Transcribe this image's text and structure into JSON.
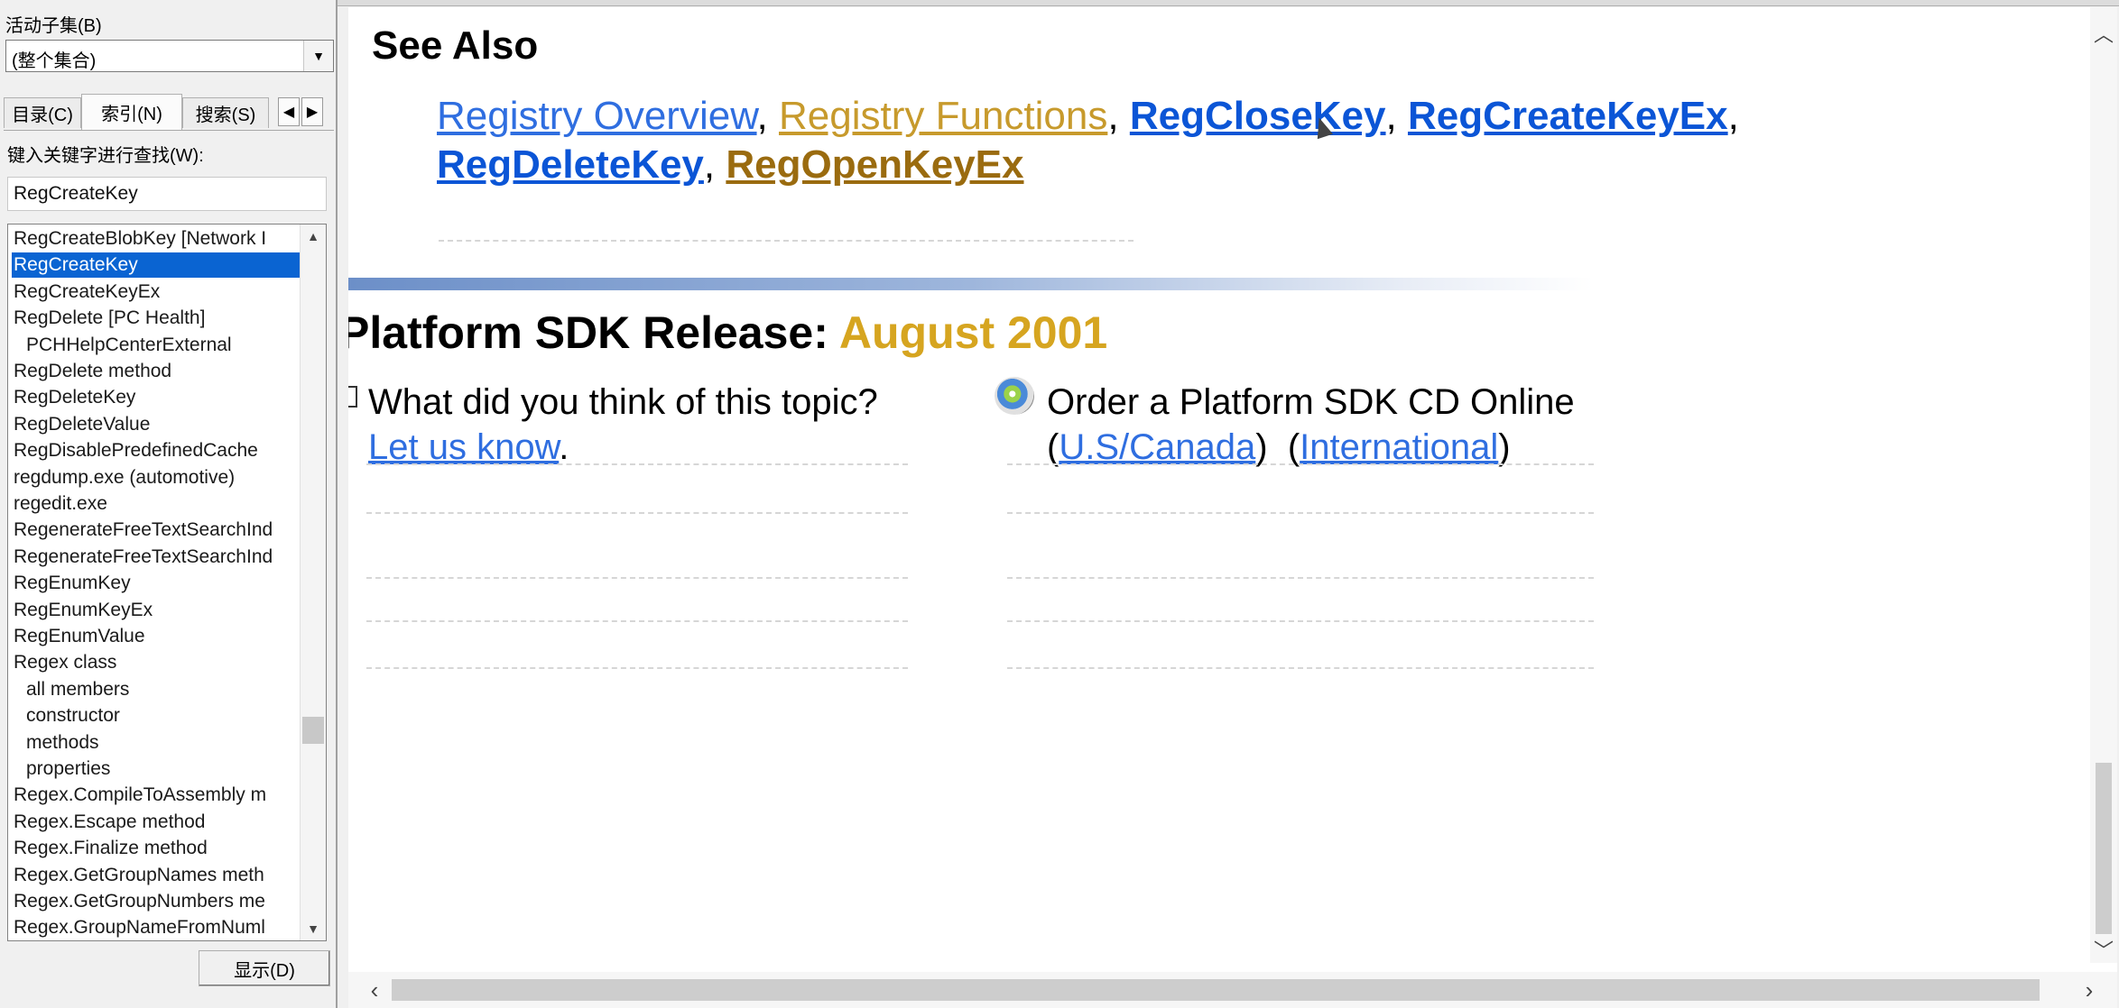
{
  "nav": {
    "subset_label": "活动子集(B)",
    "subset_value": "(整个集合)",
    "tabs": [
      {
        "label": "目录(C)"
      },
      {
        "label": "索引(N)"
      },
      {
        "label": "搜索(S)"
      }
    ],
    "keyword_label": "键入关键字进行查找(W):",
    "keyword_value": "RegCreateKey",
    "index_items": [
      {
        "label": "RegCreateBlobKey [Network I",
        "indent": false,
        "selected": false
      },
      {
        "label": "RegCreateKey",
        "indent": false,
        "selected": true
      },
      {
        "label": "RegCreateKeyEx",
        "indent": false,
        "selected": false
      },
      {
        "label": "RegDelete [PC Health]",
        "indent": false,
        "selected": false
      },
      {
        "label": "PCHHelpCenterExternal",
        "indent": true,
        "selected": false
      },
      {
        "label": "RegDelete method",
        "indent": false,
        "selected": false
      },
      {
        "label": "RegDeleteKey",
        "indent": false,
        "selected": false
      },
      {
        "label": "RegDeleteValue",
        "indent": false,
        "selected": false
      },
      {
        "label": "RegDisablePredefinedCache",
        "indent": false,
        "selected": false
      },
      {
        "label": "regdump.exe (automotive)",
        "indent": false,
        "selected": false
      },
      {
        "label": "regedit.exe",
        "indent": false,
        "selected": false
      },
      {
        "label": "RegenerateFreeTextSearchInd",
        "indent": false,
        "selected": false
      },
      {
        "label": "RegenerateFreeTextSearchInd",
        "indent": false,
        "selected": false
      },
      {
        "label": "RegEnumKey",
        "indent": false,
        "selected": false
      },
      {
        "label": "RegEnumKeyEx",
        "indent": false,
        "selected": false
      },
      {
        "label": "RegEnumValue",
        "indent": false,
        "selected": false
      },
      {
        "label": "Regex class",
        "indent": false,
        "selected": false
      },
      {
        "label": "all members",
        "indent": true,
        "selected": false
      },
      {
        "label": "constructor",
        "indent": true,
        "selected": false
      },
      {
        "label": "methods",
        "indent": true,
        "selected": false
      },
      {
        "label": "properties",
        "indent": true,
        "selected": false
      },
      {
        "label": "Regex.CompileToAssembly m",
        "indent": false,
        "selected": false
      },
      {
        "label": "Regex.Escape method",
        "indent": false,
        "selected": false
      },
      {
        "label": "Regex.Finalize method",
        "indent": false,
        "selected": false
      },
      {
        "label": "Regex.GetGroupNames meth",
        "indent": false,
        "selected": false
      },
      {
        "label": "Regex.GetGroupNumbers me",
        "indent": false,
        "selected": false
      },
      {
        "label": "Regex.GroupNameFromNuml",
        "indent": false,
        "selected": false
      }
    ],
    "display_button": "显示(D)"
  },
  "content": {
    "see_also_heading": "See Also",
    "links": {
      "registry_overview": "Registry Overview",
      "registry_functions": "Registry Functions",
      "reg_close_key": "RegCloseKey",
      "reg_create_key_ex": "RegCreateKeyEx",
      "reg_delete_key": "RegDeleteKey",
      "reg_open_key_ex": "RegOpenKeyEx",
      "separator": ","
    },
    "release_heading": "Platform SDK Release:",
    "release_date": "August 2001",
    "feedback_question": "What did you think of this topic?",
    "feedback_link": "Let us know",
    "feedback_period": ".",
    "cd_order": "Order a Platform SDK CD Online",
    "cd_link_us": "U.S/Canada",
    "cd_link_intl": "International"
  },
  "colors": {
    "link": "#2f6ee0",
    "visited_link": "#c79a2c",
    "selection": "#0a64d2",
    "release_date": "#d6a520"
  }
}
